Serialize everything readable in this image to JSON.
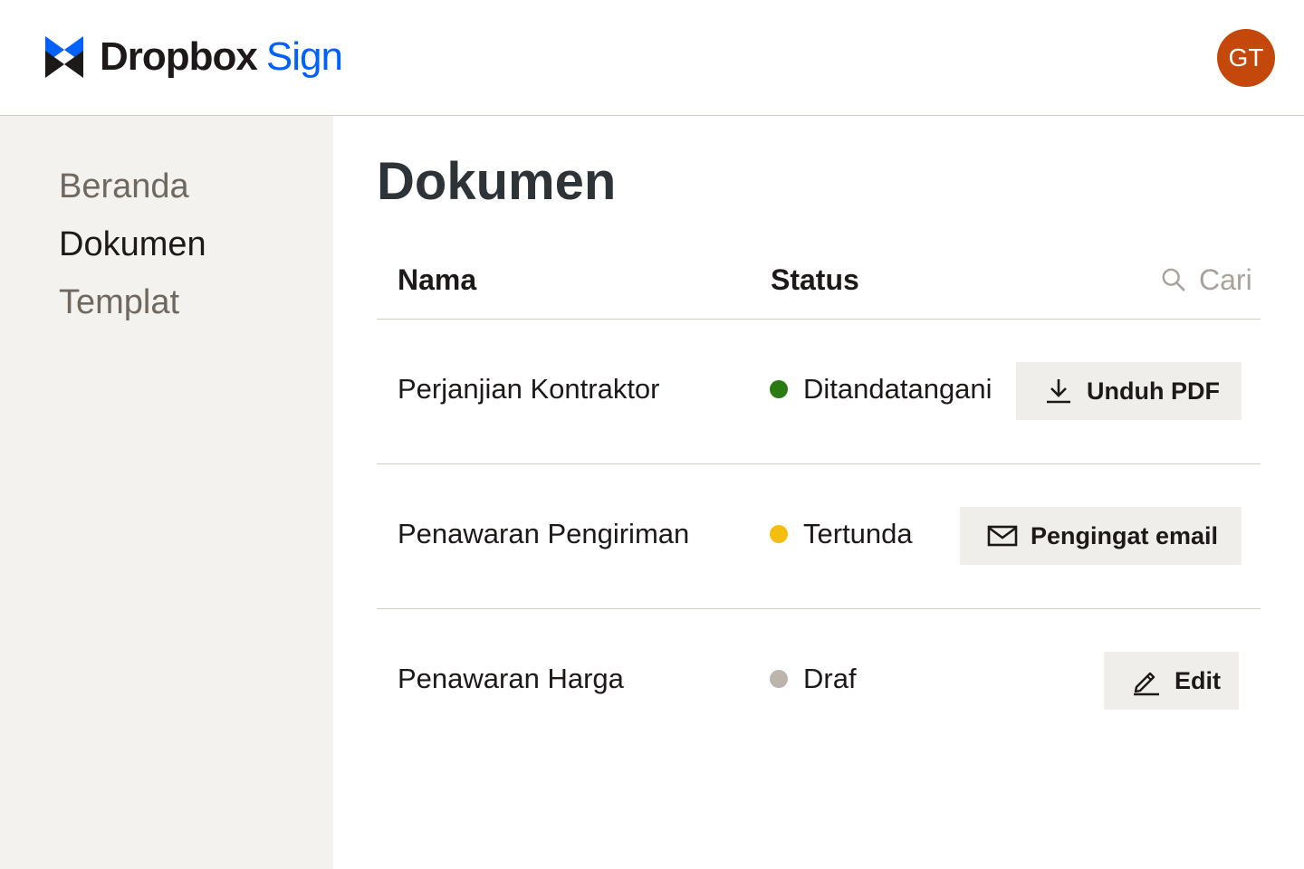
{
  "header": {
    "brand_primary": "Dropbox",
    "brand_secondary": "Sign",
    "logo_icon": "dropbox-sign-logo",
    "avatar_initials": "GT",
    "avatar_color": "#c4480c",
    "brand_color": "#0061fe"
  },
  "sidebar": {
    "items": [
      {
        "label": "Beranda",
        "active": false
      },
      {
        "label": "Dokumen",
        "active": true
      },
      {
        "label": "Templat",
        "active": false
      }
    ]
  },
  "main": {
    "title": "Dokumen",
    "columns": {
      "name": "Nama",
      "status": "Status"
    },
    "search": {
      "placeholder": "Cari",
      "icon": "search-icon"
    },
    "rows": [
      {
        "name": "Perjanjian Kontraktor",
        "status": "Ditandatangani",
        "status_color": "#2a7a12",
        "action_label": "Unduh PDF",
        "action_icon": "download-icon"
      },
      {
        "name": "Penawaran Pengiriman",
        "status": "Tertunda",
        "status_color": "#f5bd0f",
        "action_label": "Pengingat email",
        "action_icon": "envelope-icon"
      },
      {
        "name": "Penawaran Harga",
        "status": "Draf",
        "status_color": "#bbb5ae",
        "action_label": "Edit",
        "action_icon": "pencil-icon"
      }
    ]
  }
}
